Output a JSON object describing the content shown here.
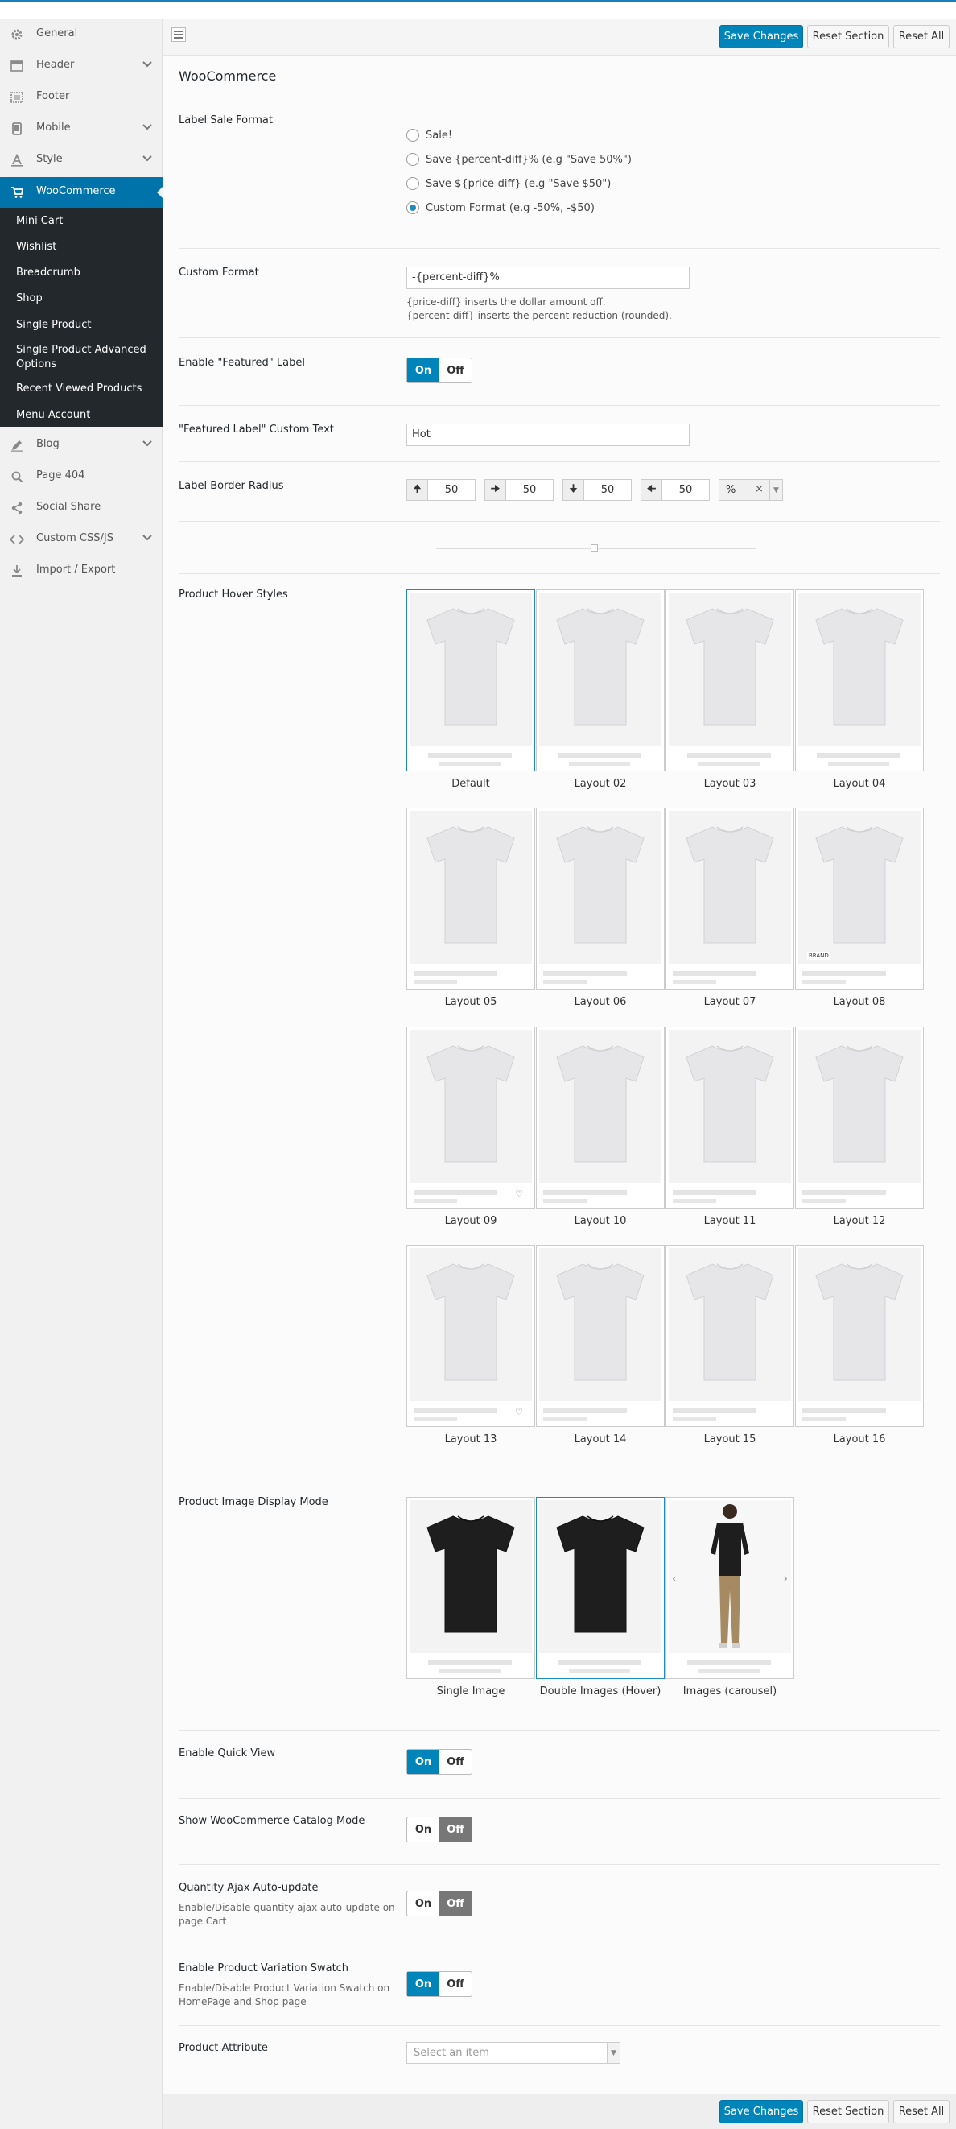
{
  "sidebar": {
    "items": [
      {
        "label": "General",
        "icon": "gear-icon"
      },
      {
        "label": "Header",
        "icon": "header-icon",
        "expandable": true
      },
      {
        "label": "Footer",
        "icon": "footer-icon"
      },
      {
        "label": "Mobile",
        "icon": "mobile-icon",
        "expandable": true
      },
      {
        "label": "Style",
        "icon": "style-icon",
        "expandable": true
      },
      {
        "label": "WooCommerce",
        "icon": "cart-icon",
        "active": true
      },
      {
        "label": "Blog",
        "icon": "pencil-icon",
        "expandable": true
      },
      {
        "label": "Page 404",
        "icon": "search-404-icon"
      },
      {
        "label": "Social Share",
        "icon": "share-icon"
      },
      {
        "label": "Custom CSS/JS",
        "icon": "code-icon",
        "expandable": true
      },
      {
        "label": "Import / Export",
        "icon": "download-icon"
      }
    ],
    "submenu": [
      "Mini Cart",
      "Wishlist",
      "Breadcrumb",
      "Shop",
      "Single Product",
      "Single Product Advanced Options",
      "Recent Viewed Products",
      "Menu Account"
    ]
  },
  "toolbar": {
    "save": "Save Changes",
    "reset_section": "Reset Section",
    "reset_all": "Reset All"
  },
  "section_title": "WooCommerce",
  "label_sale_format": {
    "label": "Label Sale Format",
    "options": [
      "Sale!",
      "Save {percent-diff}% (e.g \"Save 50%\")",
      "Save ${price-diff} (e.g \"Save $50\")",
      "Custom Format (e.g -50%, -$50)"
    ],
    "selected_index": 3
  },
  "custom_format": {
    "label": "Custom Format",
    "value": "-{percent-diff}%",
    "help1": "{price-diff} inserts the dollar amount off.",
    "help2": "{percent-diff} inserts the percent reduction (rounded)."
  },
  "featured_label": {
    "label": "Enable \"Featured\" Label",
    "on": "On",
    "off": "Off",
    "state": "on"
  },
  "featured_text": {
    "label": "\"Featured Label\" Custom Text",
    "value": "Hot"
  },
  "border_radius": {
    "label": "Label Border Radius",
    "top": "50",
    "right": "50",
    "bottom": "50",
    "left": "50",
    "unit": "%",
    "clear": "×"
  },
  "hover_styles": {
    "label": "Product Hover Styles",
    "layouts": [
      "Default",
      "Layout 02",
      "Layout 03",
      "Layout 04",
      "Layout 05",
      "Layout 06",
      "Layout 07",
      "Layout 08",
      "Layout 09",
      "Layout 10",
      "Layout 11",
      "Layout 12",
      "Layout 13",
      "Layout 14",
      "Layout 15",
      "Layout 16"
    ],
    "selected": "Default",
    "brand_text": "BRAND"
  },
  "image_display": {
    "label": "Product Image Display Mode",
    "modes": [
      "Single Image",
      "Double Images (Hover)",
      "Images (carousel)"
    ],
    "selected": "Double Images (Hover)"
  },
  "quick_view": {
    "label": "Enable Quick View",
    "on": "On",
    "off": "Off",
    "state": "on"
  },
  "catalog_mode": {
    "label": "Show WooCommerce Catalog Mode",
    "on": "On",
    "off": "Off",
    "state": "off"
  },
  "ajax_update": {
    "label": "Quantity Ajax Auto-update",
    "desc": "Enable/Disable quantity ajax auto-update on page Cart",
    "on": "On",
    "off": "Off",
    "state": "off"
  },
  "variation_swatch": {
    "label": "Enable Product Variation Swatch",
    "desc": "Enable/Disable Product Variation Swatch on HomePage and Shop page",
    "on": "On",
    "off": "Off",
    "state": "on"
  },
  "product_attribute": {
    "label": "Product Attribute",
    "placeholder": "Select an item"
  },
  "colors": {
    "accent": "#0085ba",
    "sidebar_dark": "#23282d",
    "toggle_off": "#777777"
  }
}
